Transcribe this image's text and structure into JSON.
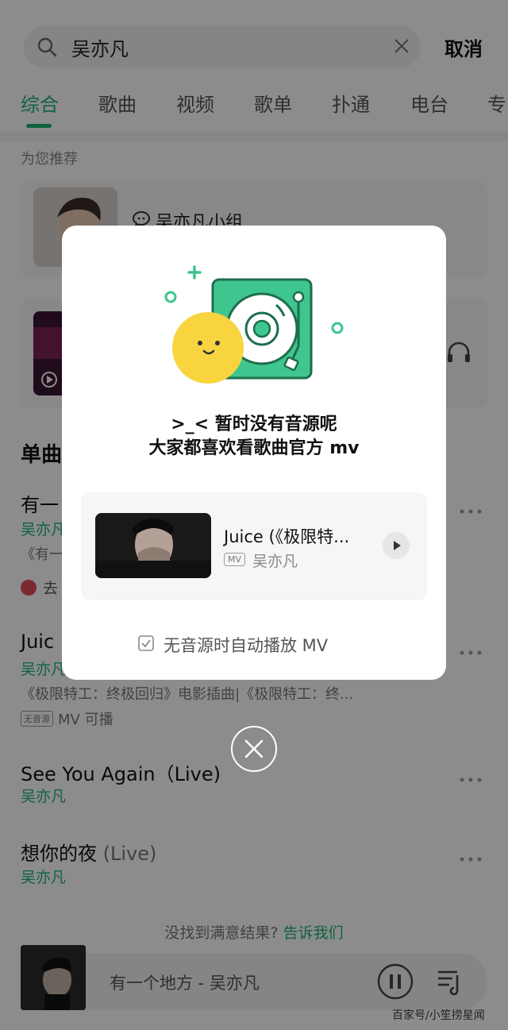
{
  "search": {
    "query": "吴亦凡",
    "cancel_label": "取消"
  },
  "tabs": [
    {
      "label": "综合",
      "active": true
    },
    {
      "label": "歌曲"
    },
    {
      "label": "视频"
    },
    {
      "label": "歌单"
    },
    {
      "label": "扑通"
    },
    {
      "label": "电台"
    },
    {
      "label": "专"
    }
  ],
  "recommend": {
    "caption": "为您推荐",
    "group_title": "吴亦凡小组"
  },
  "singles": {
    "title": "单曲"
  },
  "songs": [
    {
      "title": "有一",
      "artist": "吴亦凡",
      "desc": "《有一",
      "go_label": "去"
    },
    {
      "title": "Juic",
      "artist": "吴亦凡",
      "desc": "《极限特工：终极回归》电影插曲|《极限特工：终...",
      "badge": "无音源",
      "meta": "MV 可播"
    },
    {
      "title": "See You Again（Live)",
      "artist": "吴亦凡"
    },
    {
      "title": "想你的夜",
      "live": "(Live)",
      "artist": "吴亦凡"
    }
  ],
  "feedback": {
    "text": "没找到满意结果?",
    "link": "告诉我们"
  },
  "player": {
    "now_playing": "有一个地方 - 吴亦凡"
  },
  "watermark": "百家号/小笙捞星闻",
  "dialog": {
    "line1": ">_< 暂时没有音源呢",
    "line2": "大家都喜欢看歌曲官方 mv",
    "mv_title": "Juice (《极限特...",
    "mv_badge": "MV",
    "mv_artist": "吴亦凡",
    "auto_play_label": "无音源时自动播放 MV",
    "auto_play_checked": true
  },
  "colors": {
    "accent": "#1eb376",
    "overlay": "rgba(0,0,0,0.45)"
  }
}
